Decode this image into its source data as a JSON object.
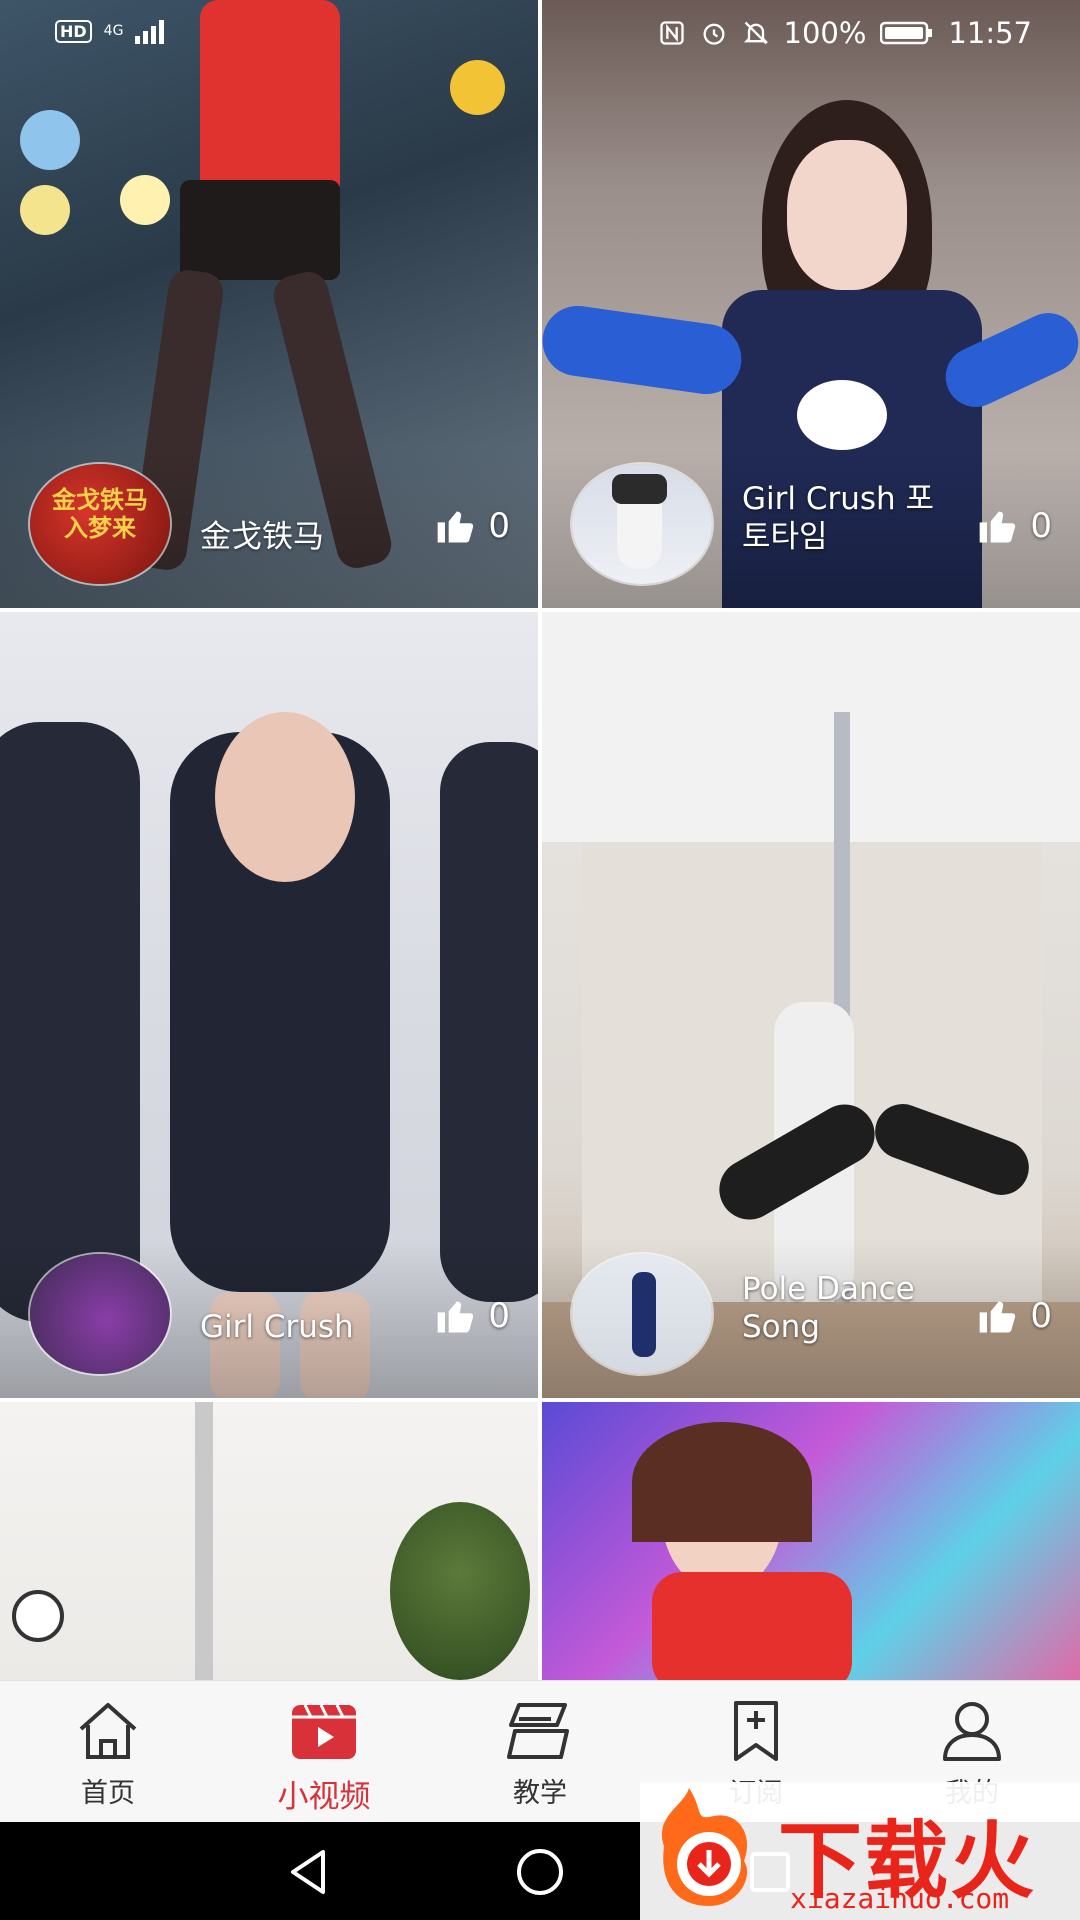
{
  "status_bar": {
    "left": {
      "hd": "HD",
      "network": "4G"
    },
    "right": {
      "battery_pct": "100%",
      "time": "11:57"
    }
  },
  "feed": [
    {
      "title": "金戈铁马",
      "likes": "0",
      "avatar_text": "金戈铁马\n入梦来"
    },
    {
      "title": "Girl Crush 포토타임",
      "likes": "0"
    },
    {
      "title": "Girl Crush",
      "likes": "0"
    },
    {
      "title": "Pole Dance Song",
      "likes": "0"
    },
    {
      "title": "",
      "likes": ""
    },
    {
      "title": "",
      "likes": ""
    }
  ],
  "bottom_nav": {
    "items": [
      {
        "label": "首页",
        "icon": "home-icon",
        "active": false
      },
      {
        "label": "小视频",
        "icon": "video-clapper-icon",
        "active": true
      },
      {
        "label": "教学",
        "icon": "teaching-icon",
        "active": false
      },
      {
        "label": "订阅",
        "icon": "subscribe-icon",
        "active": false
      },
      {
        "label": "我的",
        "icon": "user-icon",
        "active": false
      }
    ]
  },
  "watermark": {
    "brand": "下载火",
    "url": "xiazaihuo.com"
  },
  "colors": {
    "accent": "#d8313a",
    "nav_bg": "#f7f7f7"
  }
}
